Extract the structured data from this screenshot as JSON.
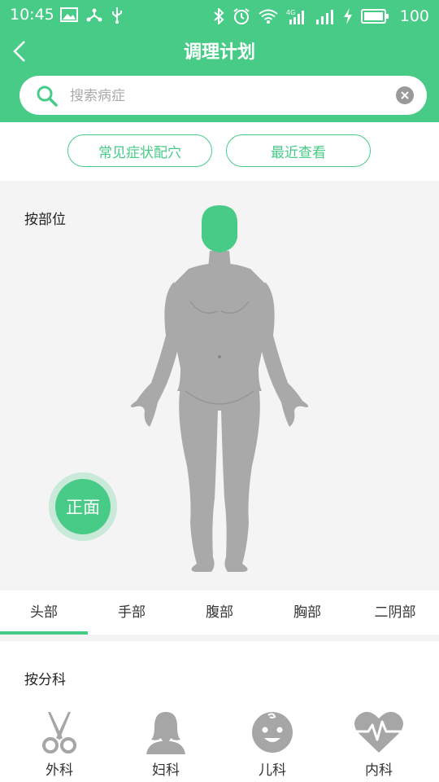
{
  "status_bar": {
    "time": "10:45",
    "battery": "100",
    "left_icons": [
      "image-icon",
      "share-icon",
      "usb-icon"
    ],
    "right_icons": [
      "bluetooth-icon",
      "alarm-icon",
      "wifi-icon",
      "signal-4g-icon",
      "signal-icon",
      "charging-icon",
      "battery-icon"
    ]
  },
  "header": {
    "title": "调理计划",
    "back_icon": "back-chevron-icon"
  },
  "search": {
    "placeholder": "搜索病症",
    "value": ""
  },
  "quick_buttons": [
    {
      "label": "常见症状配穴"
    },
    {
      "label": "最近查看"
    }
  ],
  "body_section": {
    "title": "按部位",
    "view_toggle": "正面",
    "selected_part": "头部"
  },
  "body_tabs": [
    {
      "label": "头部",
      "active": true
    },
    {
      "label": "手部",
      "active": false
    },
    {
      "label": "腹部",
      "active": false
    },
    {
      "label": "胸部",
      "active": false
    },
    {
      "label": "二阴部",
      "active": false
    }
  ],
  "department_section": {
    "title": "按分科",
    "items": [
      {
        "label": "外科",
        "icon": "scissors-icon"
      },
      {
        "label": "妇科",
        "icon": "woman-icon"
      },
      {
        "label": "儿科",
        "icon": "baby-face-icon"
      },
      {
        "label": "内科",
        "icon": "heartbeat-icon"
      }
    ]
  },
  "colors": {
    "accent": "#47cb87",
    "background": "#f4f4f4",
    "icon_gray": "#a6a6a6"
  }
}
